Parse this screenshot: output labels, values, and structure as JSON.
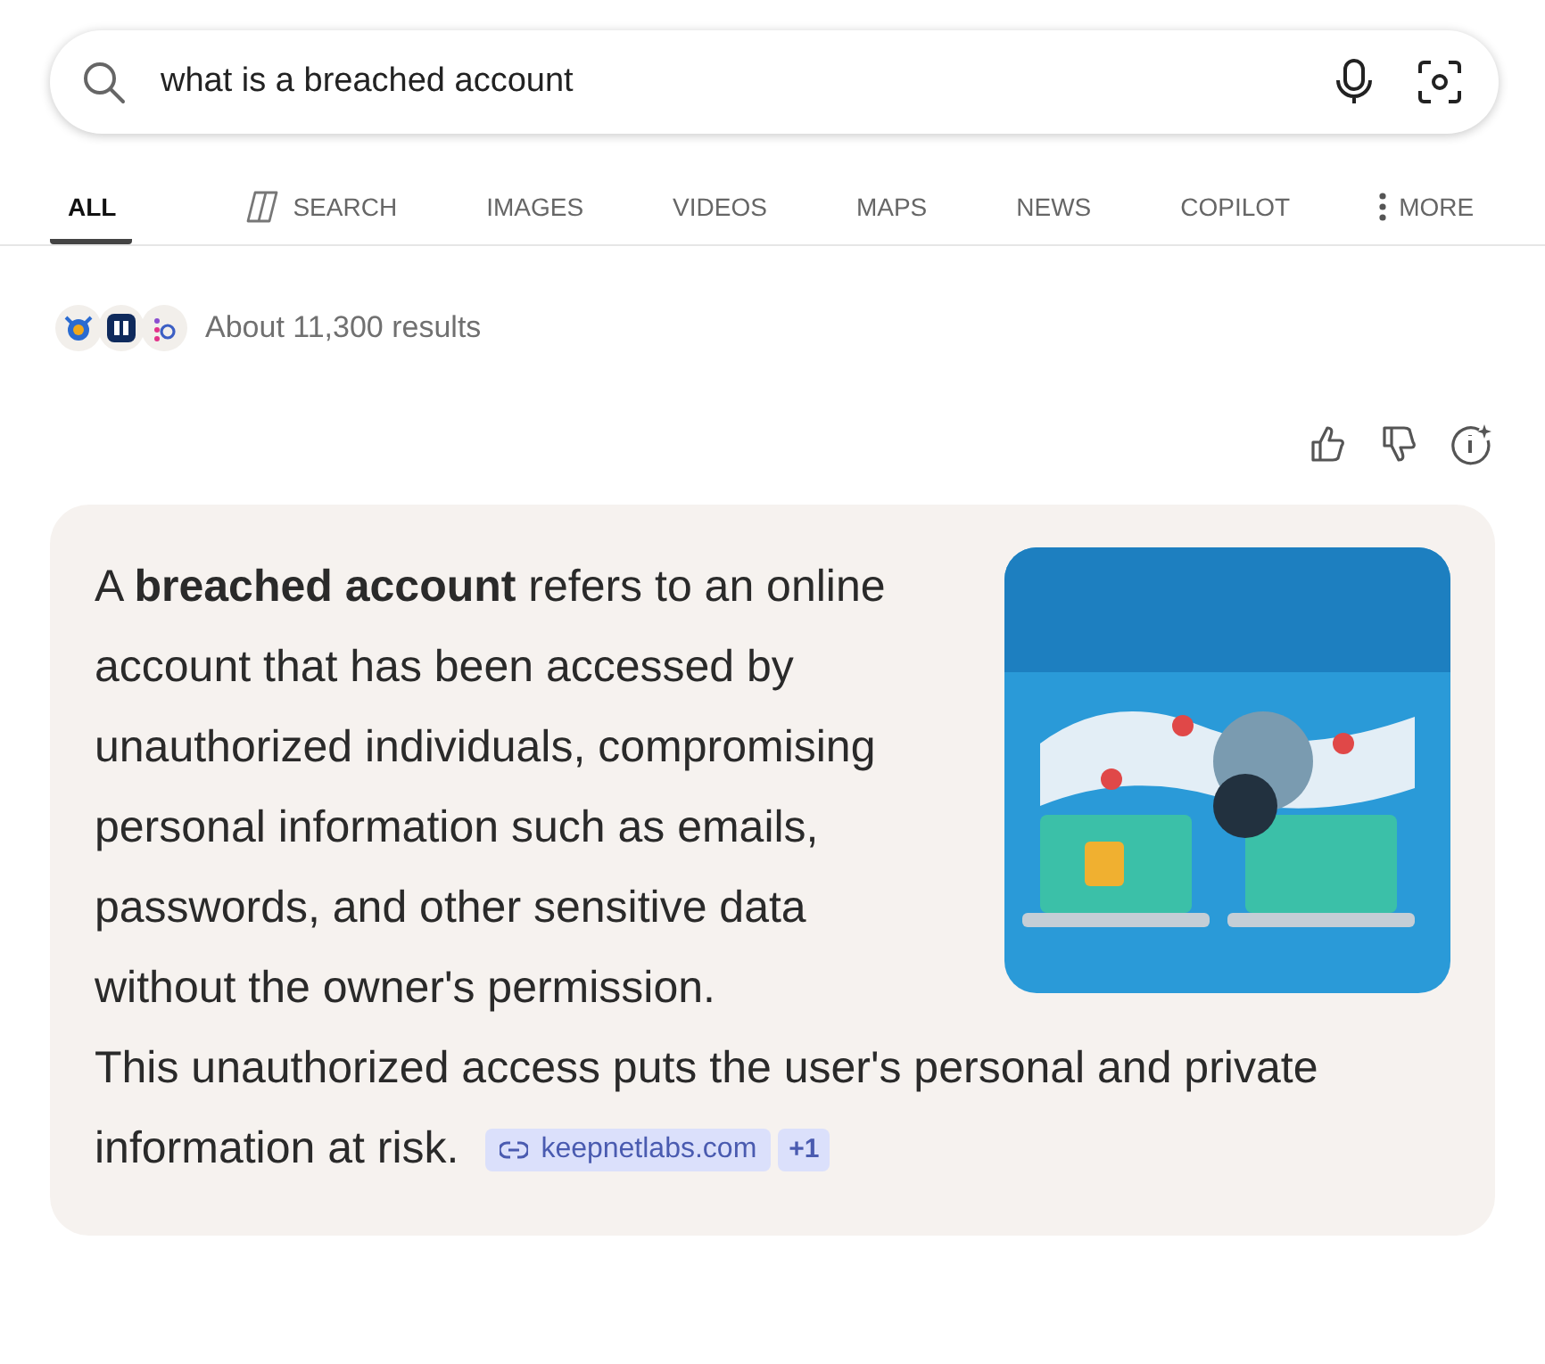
{
  "search": {
    "value": "what is a breached account"
  },
  "tabs": [
    {
      "label": "ALL",
      "selected": true,
      "kind": "plain"
    },
    {
      "label": "SEARCH",
      "selected": false,
      "kind": "copilot"
    },
    {
      "label": "IMAGES",
      "selected": false,
      "kind": "plain"
    },
    {
      "label": "VIDEOS",
      "selected": false,
      "kind": "plain"
    },
    {
      "label": "MAPS",
      "selected": false,
      "kind": "plain"
    },
    {
      "label": "NEWS",
      "selected": false,
      "kind": "plain"
    },
    {
      "label": "COPILOT",
      "selected": false,
      "kind": "plain"
    },
    {
      "label": "MORE",
      "selected": false,
      "kind": "more"
    }
  ],
  "results_count": "About 11,300 results",
  "answer": {
    "sentences": [
      "A **breached account** refers to an online account that has been accessed by unauthorized individuals, compromising personal information such as emails, passwords, and other sensitive data without the owner's permission.",
      "This unauthorized access puts the user's personal and private information at risk."
    ],
    "source": "keepnetlabs.com",
    "more_sources": "+1"
  }
}
